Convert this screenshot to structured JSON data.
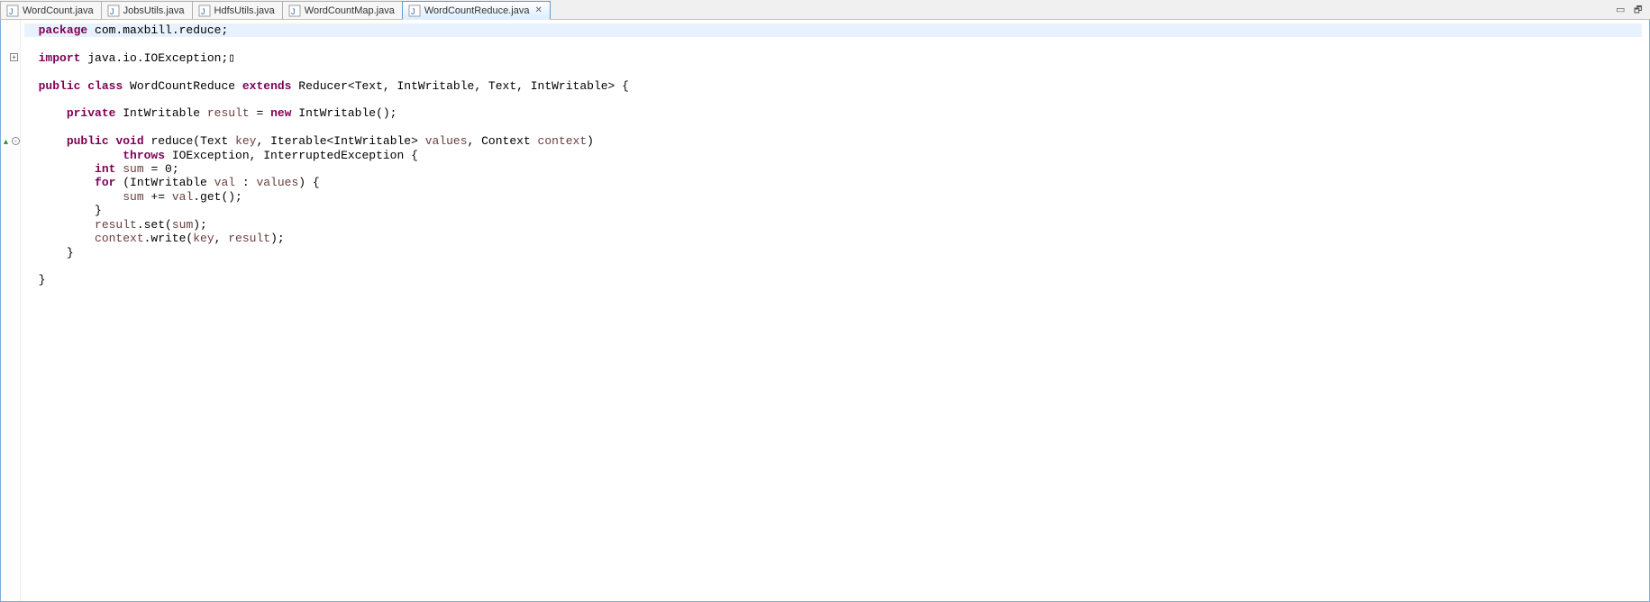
{
  "tabs": [
    {
      "label": "WordCount.java",
      "active": false
    },
    {
      "label": "JobsUtils.java",
      "active": false
    },
    {
      "label": "HdfsUtils.java",
      "active": false
    },
    {
      "label": "WordCountMap.java",
      "active": false
    },
    {
      "label": "WordCountReduce.java",
      "active": true
    }
  ],
  "close_glyph": "✕",
  "code": {
    "package_kw": "package",
    "package_name": " com.maxbill.reduce;",
    "import_kw": "import",
    "import_name": " java.io.IOException;",
    "public_kw": "public",
    "class_kw": "class",
    "classname": " WordCountReduce ",
    "extends_kw": "extends",
    "extends_rest": " Reducer<Text, IntWritable, Text, IntWritable> {",
    "private_kw": "private",
    "field_type": " IntWritable ",
    "field_name": "result",
    "field_eq": " = ",
    "new_kw": "new",
    "field_ctor": " IntWritable();",
    "void_kw": "void",
    "method_name": " reduce(Text ",
    "p_key": "key",
    "p_comma1": ", Iterable<IntWritable> ",
    "p_values": "values",
    "p_comma2": ", Context ",
    "p_context": "context",
    "p_close": ")",
    "throws_kw": "throws",
    "throws_rest": " IOException, InterruptedException {",
    "int_kw": "int",
    "sum_decl_name": " sum",
    "sum_decl_rest": " = 0;",
    "for_kw": "for",
    "for_open": " (IntWritable ",
    "for_var": "val",
    "for_colon": " : ",
    "for_iter": "values",
    "for_close": ") {",
    "sum_plus": "sum",
    "sum_pluseq": " += ",
    "val_ref": "val",
    "getcall": ".get();",
    "brace_close1": "}",
    "result_ref": "result",
    "set_call_a": ".set(",
    "set_arg": "sum",
    "set_call_b": ");",
    "context_ref": "context",
    "write_a": ".write(",
    "write_key": "key",
    "write_sep": ", ",
    "write_res": "result",
    "write_b": ");",
    "brace_close2": "}",
    "brace_close3": "}"
  }
}
